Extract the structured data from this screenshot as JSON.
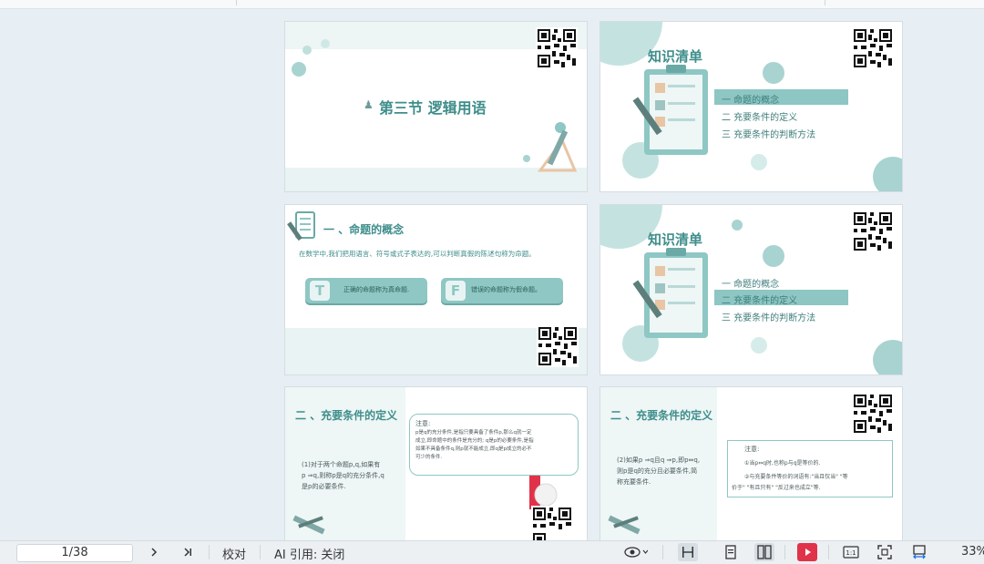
{
  "slides": {
    "s1": {
      "title": "第三节  逻辑用语"
    },
    "s2": {
      "heading": "知识清单",
      "items": [
        "一  命题的概念",
        "二  充要条件的定义",
        "三  充要条件的判断方法"
      ]
    },
    "s3": {
      "heading": "一 、命题的概念",
      "body": "在数学中,我们把用语言、符号或式子表达的,可以判断真假的陈述句称为命题。",
      "t_letter": "T",
      "t_text": "正确的命题称为真命题.",
      "f_letter": "F",
      "f_text": "错误的命题称为假命题。"
    },
    "s4": {
      "heading": "知识清单",
      "items": [
        "一  命题的概念",
        "二  充要条件的定义",
        "三  充要条件的判断方法"
      ]
    },
    "s5": {
      "heading": "二 、充要条件的定义",
      "left_l1": "(1)对于两个命题p,q,如果有",
      "left_l2": "p ⇒q,则称p是q的充分条件,q",
      "left_l3": "是p的必要条件.",
      "note_title": "注意:",
      "note_l1": "p是q的充分条件,是指只要具备了条件p,那么q就一定",
      "note_l2": "成立,即命题中的条件是充分的; q是p的必要条件,是指",
      "note_l3": "如果不具备条件q,则p就不能成立,即q是p成立的必不",
      "note_l4": "可少的条件."
    },
    "s6": {
      "heading": "二 、充要条件的定义",
      "left_l1": "(2)如果p ⇒q且q ⇒p,即p⇔q,",
      "left_l2": "则p是q的充分且必要条件,简",
      "left_l3": "称充要条件.",
      "note_title": "注意:",
      "note_l1": "①当p⇔q时,也称p与q是等价的.",
      "note_l2": "②与充要条件等价的词语有:\"当且仅当\" \"等",
      "note_l3": "价于\" \"有且只有\" \"反过来也成立\"等."
    }
  },
  "statusbar": {
    "page_indicator": "1/38",
    "proofread": "校对",
    "ai_cite": "AI 引用: 关闭",
    "zoom": "33%"
  },
  "colors": {
    "teal": "#3f8e8b",
    "accent": "#8ec7c3",
    "play_red": "#e0334a"
  },
  "icons": [
    "next-page-icon",
    "last-page-icon",
    "eye-icon",
    "fit-width-icon",
    "single-page-icon",
    "double-page-icon",
    "play-icon",
    "actual-size-icon",
    "fit-screen-icon",
    "fit-page-width-icon"
  ]
}
